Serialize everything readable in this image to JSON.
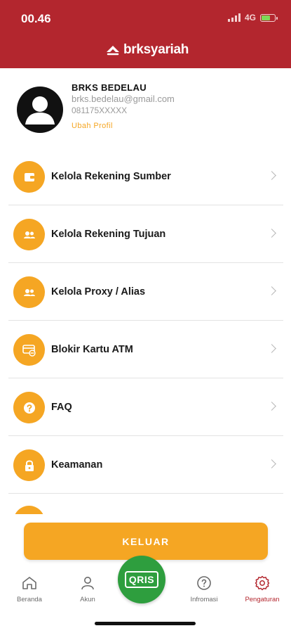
{
  "status_bar": {
    "time": "00.46",
    "network": "4G",
    "battery_icon": "battery-charging-icon",
    "signal_icon": "signal-icon"
  },
  "header": {
    "brand": "brksyariah",
    "bg_color": "#b3262e"
  },
  "profile": {
    "name": "BRKS BEDELAU",
    "email": "brks.bedelau@gmail.com",
    "phone": "081175XXXXX",
    "edit_label": "Ubah Profil"
  },
  "menu": {
    "items": [
      {
        "label": "Kelola Rekening Sumber",
        "icon": "wallet-icon"
      },
      {
        "label": "Kelola Rekening Tujuan",
        "icon": "users-icon"
      },
      {
        "label": "Kelola Proxy / Alias",
        "icon": "users-icon"
      },
      {
        "label": "Blokir Kartu ATM",
        "icon": "card-block-icon"
      },
      {
        "label": "FAQ",
        "icon": "question-icon"
      },
      {
        "label": "Keamanan",
        "icon": "lock-icon"
      }
    ]
  },
  "logout": {
    "label": "KELUAR"
  },
  "bottom_nav": {
    "items": [
      {
        "label": "Beranda",
        "icon": "home-icon"
      },
      {
        "label": "Akun",
        "icon": "user-icon"
      },
      {
        "label": "Infromasi",
        "icon": "help-circle-icon"
      },
      {
        "label": "Pengaturan",
        "icon": "settings-icon",
        "active": true
      }
    ],
    "qris_label": "QRIS"
  },
  "colors": {
    "accent": "#f5a623",
    "brand": "#b3262e",
    "qris": "#2e9e3e"
  }
}
